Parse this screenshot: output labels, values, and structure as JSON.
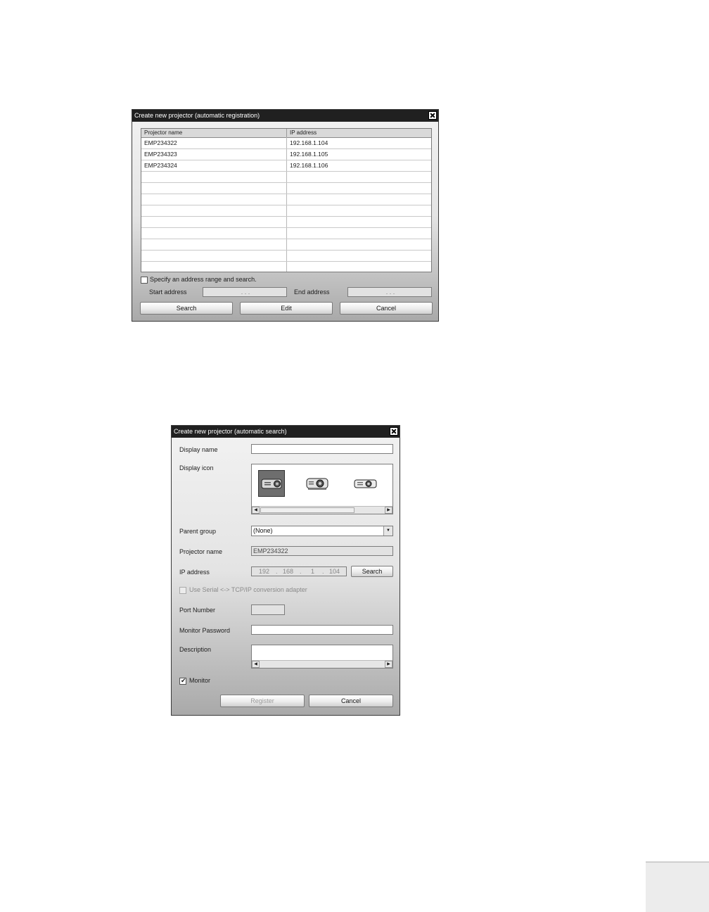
{
  "dialog1": {
    "title": "Create new projector (automatic registration)",
    "columns": [
      "Projector name",
      "IP address"
    ],
    "rows": [
      [
        "EMP234322",
        "192.168.1.104"
      ],
      [
        "EMP234323",
        "192.168.1.105"
      ],
      [
        "EMP234324",
        "192.168.1.106"
      ]
    ],
    "range_checkbox_label": "Specify an address range and search.",
    "start_address_label": "Start address",
    "end_address_label": "End address",
    "start_address_value": ".   .   .",
    "end_address_value": ".   .   .",
    "search_button": "Search",
    "edit_button": "Edit",
    "cancel_button": "Cancel"
  },
  "dialog2": {
    "title": "Create new projector (automatic search)",
    "display_name_label": "Display name",
    "display_name_value": "",
    "display_icon_label": "Display icon",
    "parent_group_label": "Parent group",
    "parent_group_value": "(None)",
    "projector_name_label": "Projector name",
    "projector_name_value": "EMP234322",
    "ip_address_label": "IP address",
    "ip_octets": [
      "192",
      "168",
      "1",
      "104"
    ],
    "ip_search_button": "Search",
    "serial_checkbox_label": "Use Serial <-> TCP/IP conversion adapter",
    "port_number_label": "Port Number",
    "port_number_value": "",
    "monitor_password_label": "Monitor Password",
    "monitor_password_value": "",
    "description_label": "Description",
    "description_value": "",
    "monitor_checkbox_label": "Monitor",
    "monitor_checked": "✔",
    "register_button": "Register",
    "cancel_button": "Cancel"
  }
}
